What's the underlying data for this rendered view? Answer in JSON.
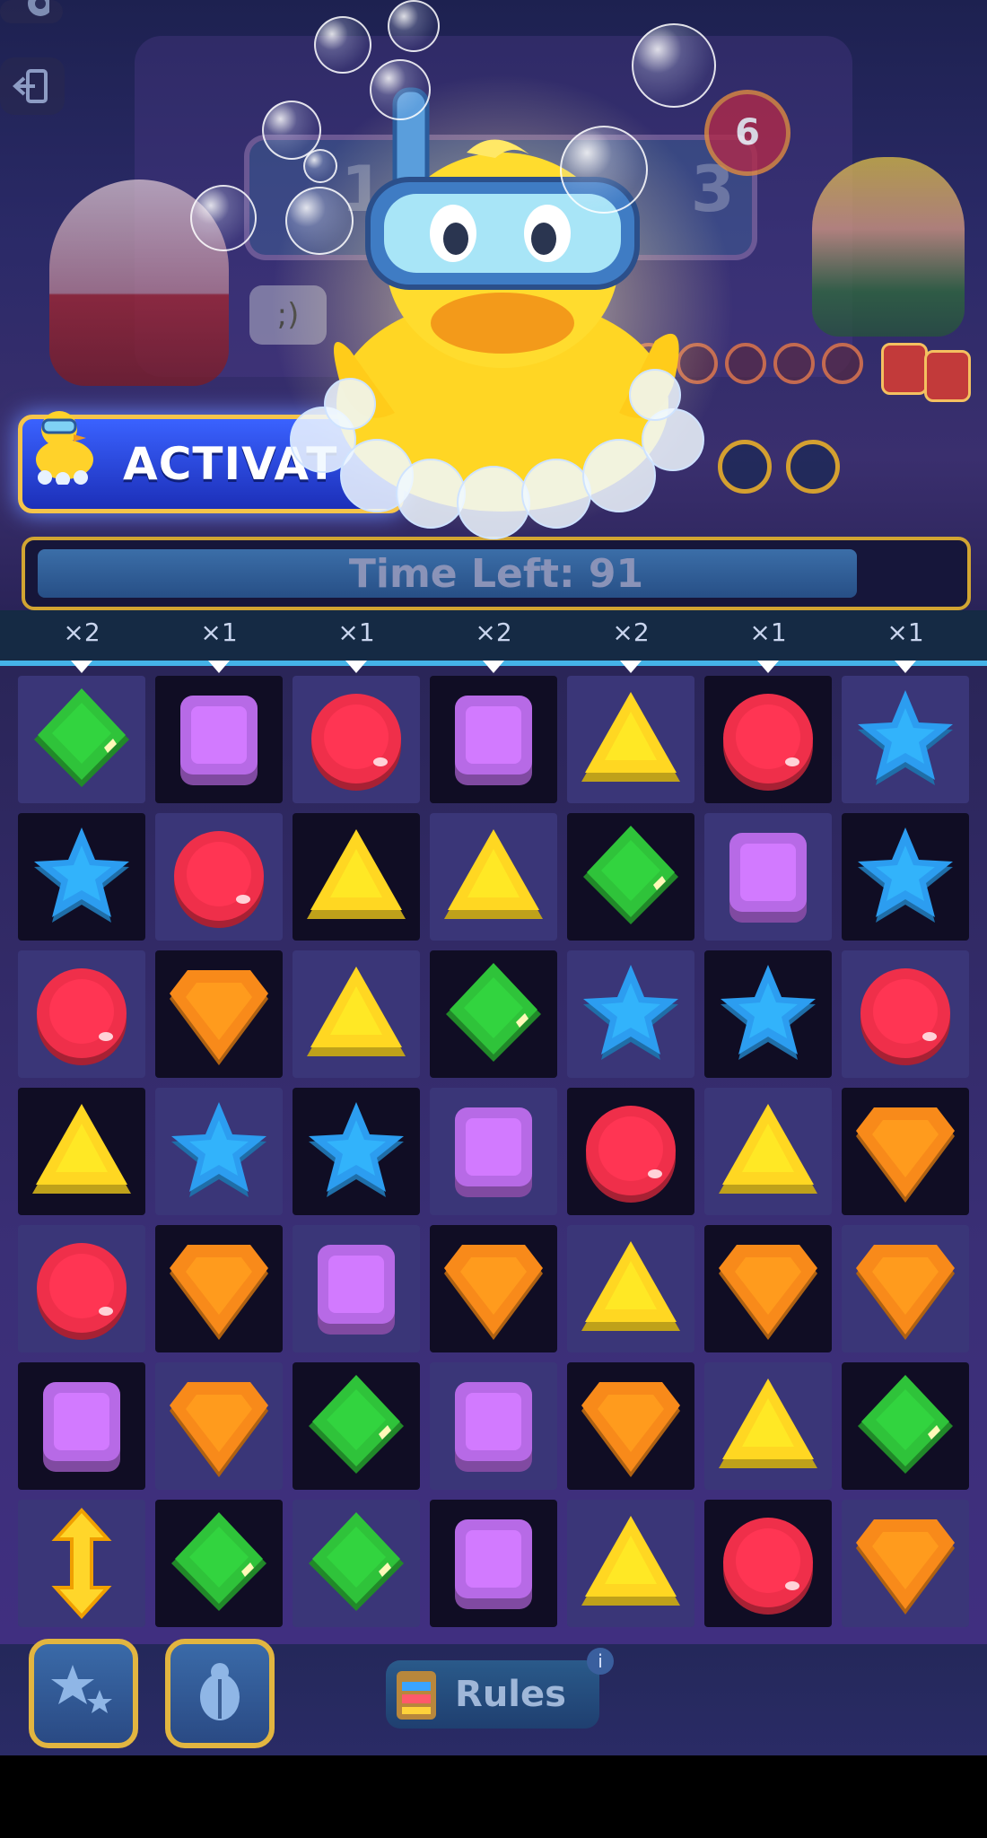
{
  "top_bar": {
    "settings_icon": "gear-icon",
    "exit_icon": "exit-door-icon",
    "level_badge": "6"
  },
  "booster": {
    "activate_label": "ACTIVAT",
    "character": "rubber-duck-with-snorkel"
  },
  "timer": {
    "label": "Time Left: 91",
    "progress": 0.9
  },
  "multipliers": [
    "×2",
    "×1",
    "×1",
    "×2",
    "×2",
    "×1",
    "×1"
  ],
  "board": {
    "rows": [
      [
        "green",
        "purple",
        "red",
        "purple",
        "yellow",
        "red",
        "blue"
      ],
      [
        "blue",
        "red",
        "yellow",
        "yellow",
        "green",
        "purple",
        "blue"
      ],
      [
        "red",
        "orange",
        "yellow",
        "green",
        "blue",
        "blue",
        "red"
      ],
      [
        "yellow",
        "blue",
        "blue",
        "purple",
        "red",
        "yellow",
        "orange"
      ],
      [
        "red",
        "orange",
        "purple",
        "orange",
        "yellow",
        "orange",
        "orange"
      ],
      [
        "purple",
        "orange",
        "green",
        "purple",
        "orange",
        "yellow",
        "green"
      ],
      [
        "swap",
        "green",
        "green",
        "purple",
        "yellow",
        "red",
        "orange"
      ]
    ],
    "gem_colors": {
      "green": "#2fc33a",
      "purple": "#b76ae6",
      "red": "#ef2f4a",
      "yellow": "#ffd722",
      "blue": "#2c9df0",
      "orange": "#f88a1a"
    }
  },
  "bottom": {
    "power1_icon": "stars-icon",
    "power2_icon": "scarab-icon",
    "rules_label": "Rules",
    "info_icon": "info-icon"
  }
}
